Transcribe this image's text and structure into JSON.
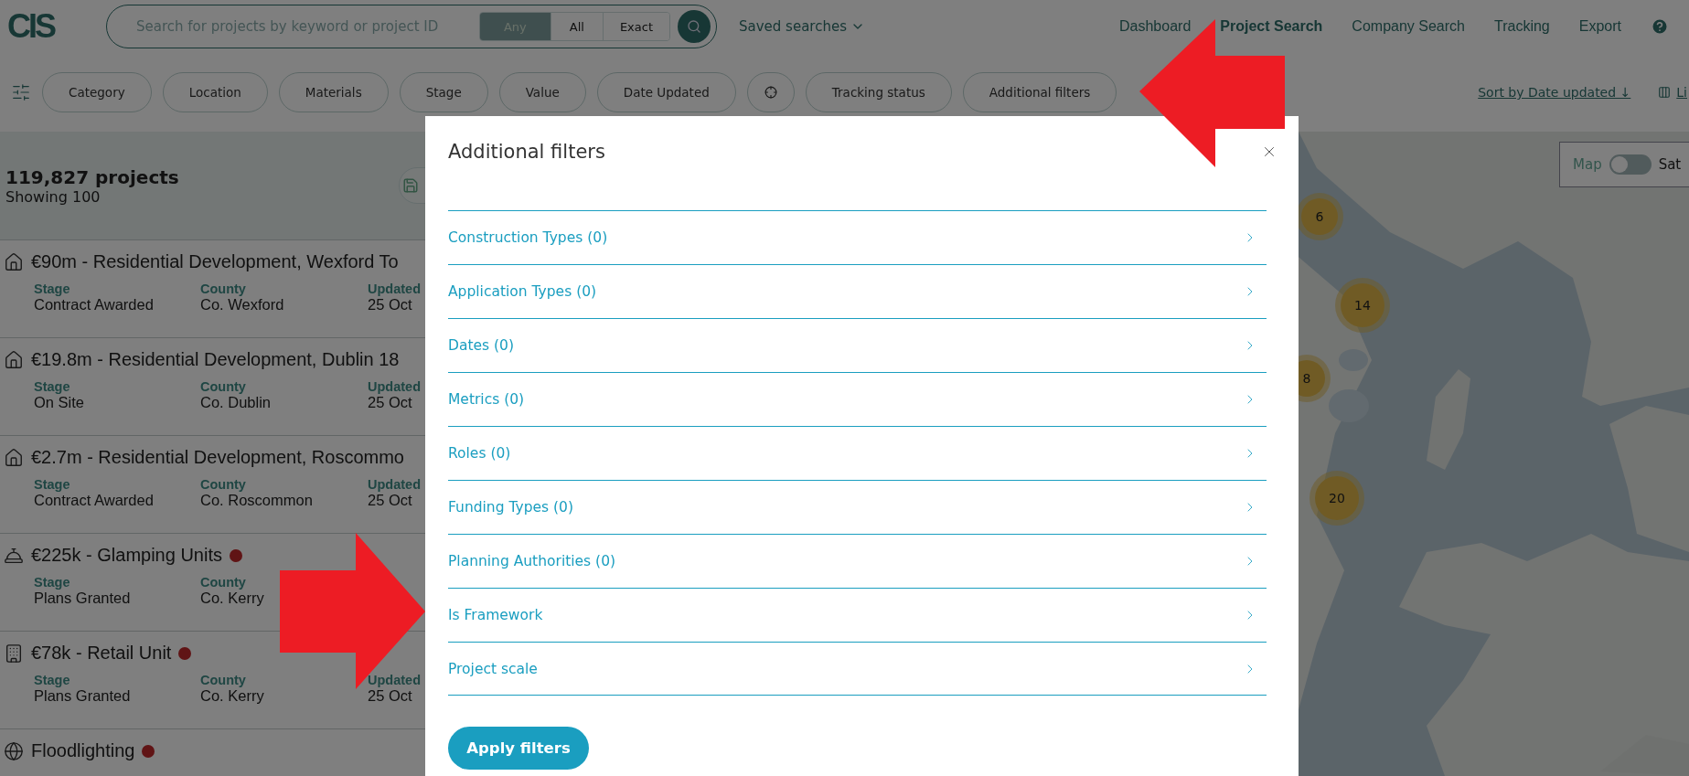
{
  "header": {
    "logo": "CIS",
    "search": {
      "placeholder": "Search for projects by keyword or project ID",
      "modes": [
        {
          "label": "Any",
          "selected": true
        },
        {
          "label": "All",
          "selected": false
        },
        {
          "label": "Exact",
          "selected": false
        }
      ]
    },
    "saved_searches": "Saved searches",
    "nav": [
      {
        "label": "Dashboard",
        "selected": false
      },
      {
        "label": "Project Search",
        "selected": true
      },
      {
        "label": "Company Search",
        "selected": false
      },
      {
        "label": "Tracking",
        "selected": false
      },
      {
        "label": "Export",
        "selected": false
      }
    ]
  },
  "filters": {
    "pills": [
      {
        "kind": "text",
        "label": "Category"
      },
      {
        "kind": "text",
        "label": "Location"
      },
      {
        "kind": "text",
        "label": "Materials"
      },
      {
        "kind": "text",
        "label": "Stage"
      },
      {
        "kind": "text",
        "label": "Value"
      },
      {
        "kind": "text",
        "label": "Date Updated"
      },
      {
        "kind": "locate"
      },
      {
        "kind": "text",
        "label": "Tracking status"
      },
      {
        "kind": "text",
        "label": "Additional filters"
      }
    ],
    "sort": "Sort by Date updated ↓",
    "view": "Li"
  },
  "results": {
    "count": "119,827 projects",
    "showing": "Showing 100"
  },
  "projects": [
    {
      "title": "€90m - Residential Development, Wexford To",
      "flagged": false,
      "fields": [
        {
          "label": "Stage",
          "value": "Contract Awarded"
        },
        {
          "label": "County",
          "value": "Co. Wexford"
        },
        {
          "label": "Updated",
          "value": "25 Oct"
        }
      ]
    },
    {
      "title": "€19.8m - Residential Development, Dublin 18",
      "flagged": false,
      "fields": [
        {
          "label": "Stage",
          "value": "On Site"
        },
        {
          "label": "County",
          "value": "Co. Dublin"
        },
        {
          "label": "Updated",
          "value": "25 Oct"
        }
      ]
    },
    {
      "title": "€2.7m - Residential Development, Roscommo",
      "flagged": false,
      "fields": [
        {
          "label": "Stage",
          "value": "Contract Awarded"
        },
        {
          "label": "County",
          "value": "Co. Roscommon"
        },
        {
          "label": "Updated",
          "value": "25 Oct"
        }
      ]
    },
    {
      "title": "€225k - Glamping Units",
      "flagged": true,
      "fields": [
        {
          "label": "Stage",
          "value": "Plans Granted"
        },
        {
          "label": "County",
          "value": "Co. Kerry"
        }
      ]
    },
    {
      "title": "€78k - Retail Unit",
      "flagged": true,
      "fields": [
        {
          "label": "Stage",
          "value": "Plans Granted"
        },
        {
          "label": "County",
          "value": "Co. Kerry"
        },
        {
          "label": "Updated",
          "value": "25 Oct"
        }
      ]
    },
    {
      "title": "Floodlighting",
      "flagged": true
    }
  ],
  "map": {
    "toggle": {
      "label": "Map",
      "on": false,
      "other": "Sat"
    },
    "clusters": [
      "6",
      "14",
      "8",
      "20"
    ]
  },
  "modal": {
    "title": "Additional filters",
    "items": [
      {
        "label": "Construction Types (0)"
      },
      {
        "label": "Application Types (0)"
      },
      {
        "label": "Dates (0)"
      },
      {
        "label": "Metrics (0)"
      },
      {
        "label": "Roles (0)"
      },
      {
        "label": "Funding Types (0)"
      },
      {
        "label": "Planning Authorities (0)"
      },
      {
        "label": "Is Framework"
      },
      {
        "label": "Project scale"
      }
    ],
    "apply": "Apply filters"
  }
}
